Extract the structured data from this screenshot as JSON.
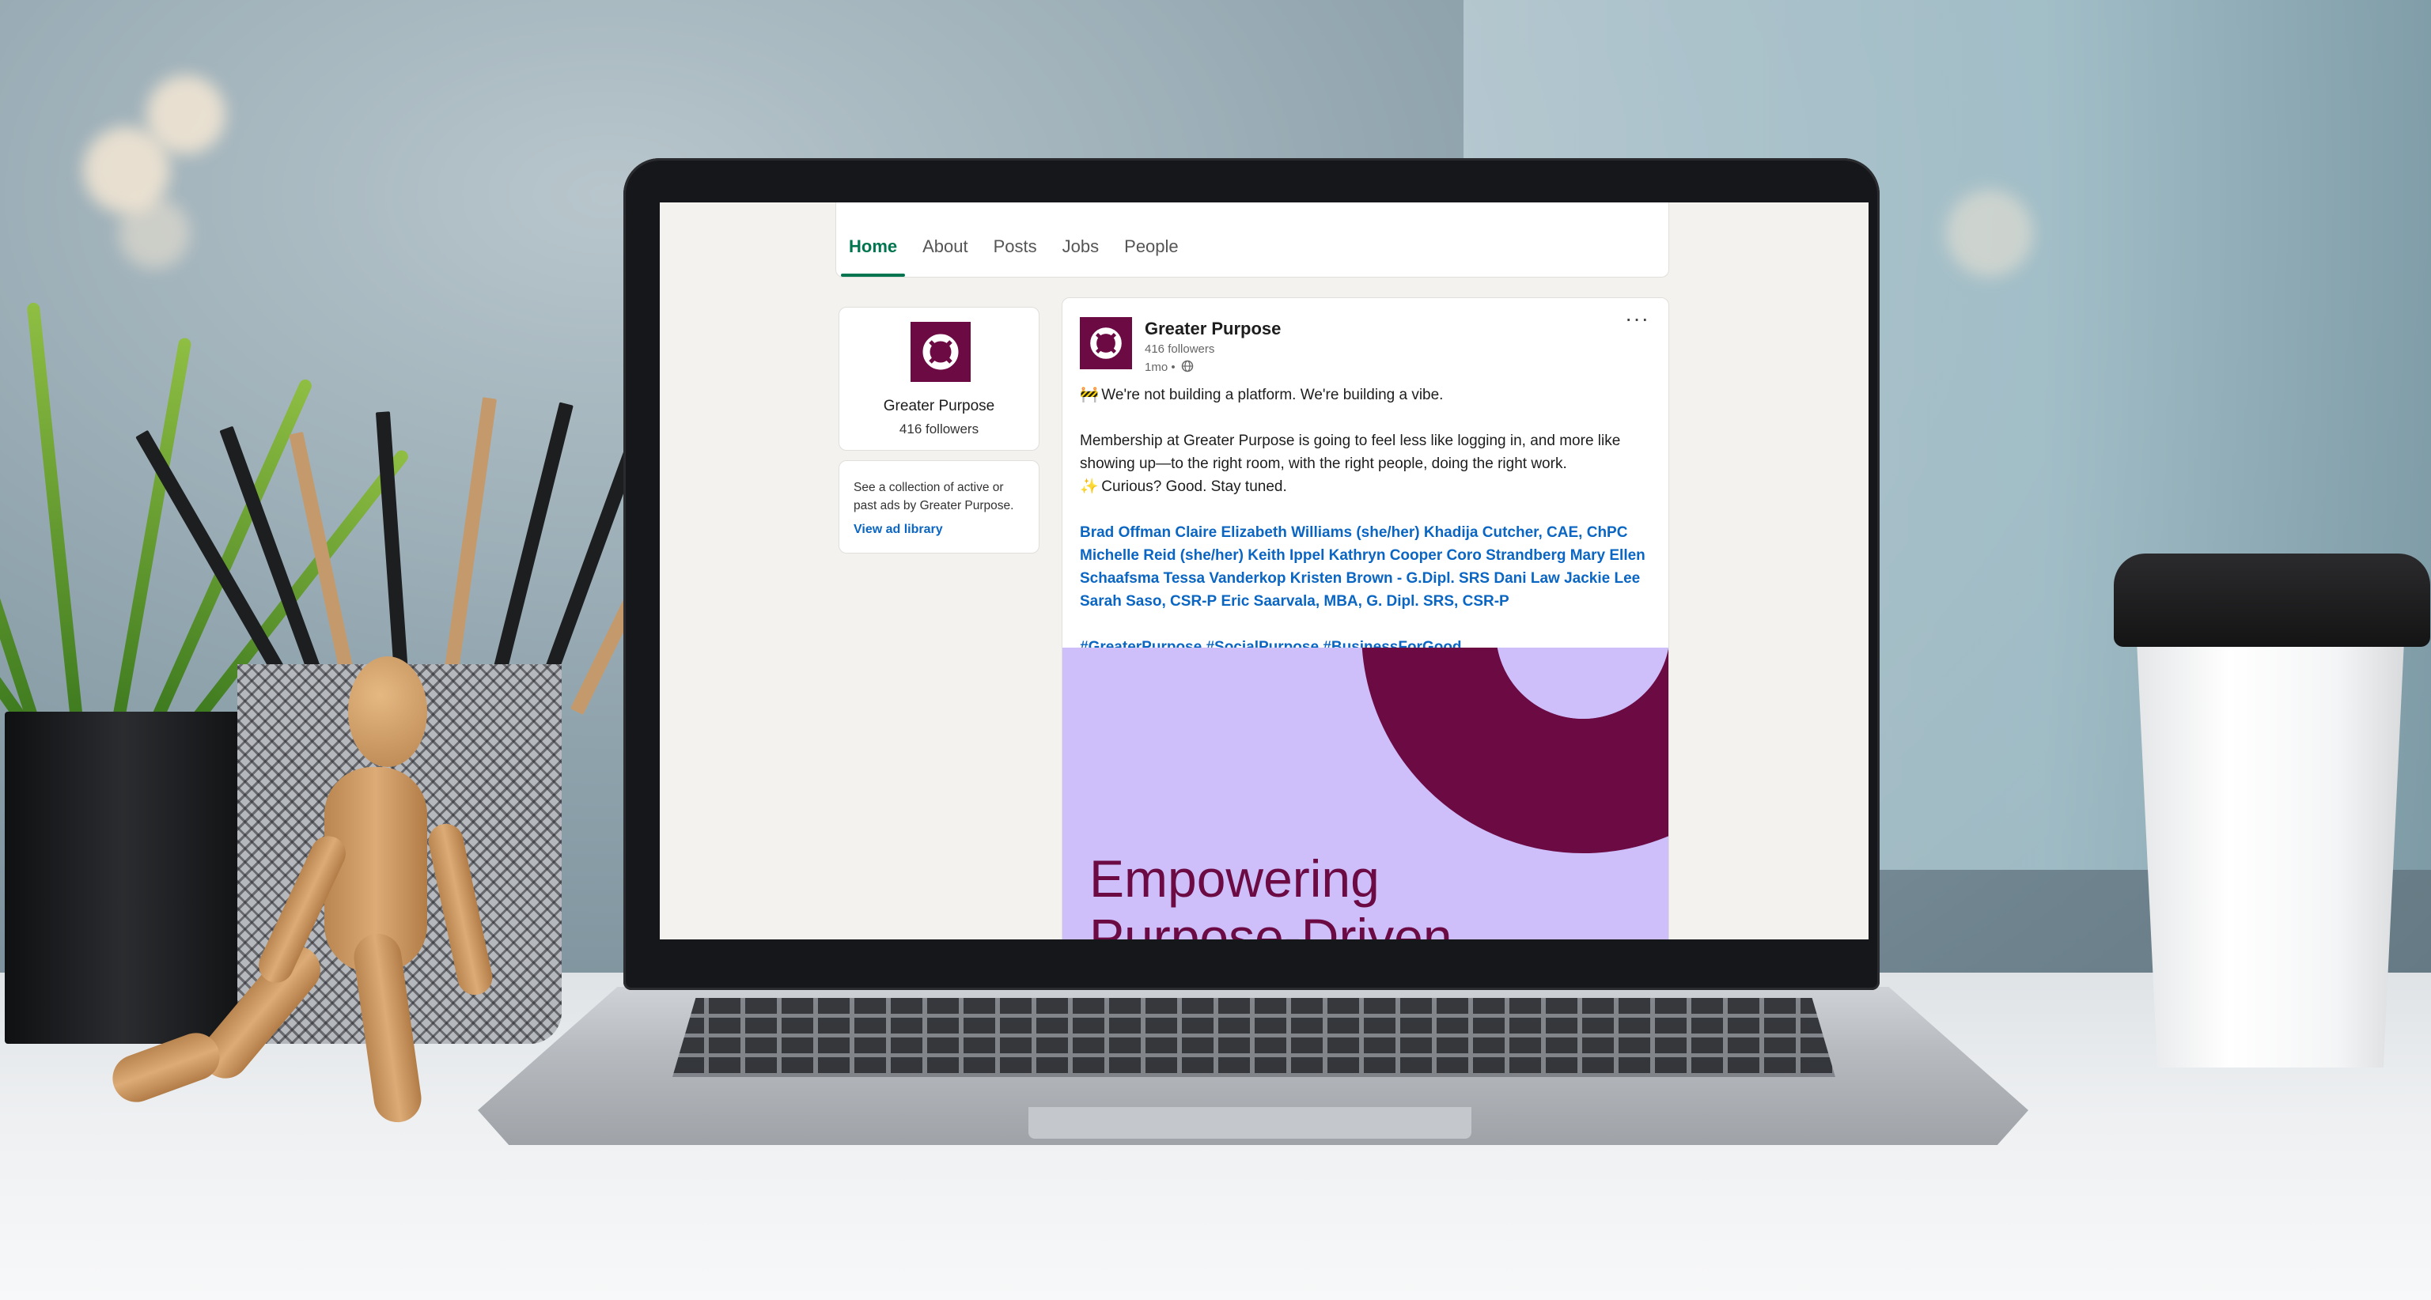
{
  "page": {
    "tabs": [
      {
        "label": "Home",
        "active": true
      },
      {
        "label": "About",
        "active": false
      },
      {
        "label": "Posts",
        "active": false
      },
      {
        "label": "Jobs",
        "active": false
      },
      {
        "label": "People",
        "active": false
      }
    ]
  },
  "company_card": {
    "name": "Greater Purpose",
    "followers": "416 followers"
  },
  "ads_card": {
    "description": "See a collection of active or past ads by Greater Purpose.",
    "link": "View ad library"
  },
  "post": {
    "author": "Greater Purpose",
    "followers": "416 followers",
    "time": "1mo •",
    "visibility_icon": "globe-icon",
    "more_label": "···",
    "line1_icon": "construction-sign",
    "line1": "We're not building a platform. We're building a vibe.",
    "line2": "Membership at Greater Purpose is going to feel less like logging in, and more like showing up—to the right room, with the right people, doing the right work.",
    "line3_icon": "sparkles",
    "line3": "Curious? Good. Stay tuned.",
    "mentions": [
      "Brad Offman",
      "Claire Elizabeth Williams (she/her)",
      "Khadija Cutcher, CAE, ChPC",
      "Michelle Reid (she/her)",
      "Keith Ippel",
      "Kathryn Cooper",
      "Coro Strandberg",
      "Mary Ellen Schaafsma",
      "Tessa Vanderkop",
      "Kristen Brown - G.Dipl. SRS",
      "Dani Law",
      "Jackie Lee",
      "Sarah Saso, CSR-P",
      "Eric Saarvala, MBA, G. Dipl. SRS, CSR-P"
    ],
    "hashtags": "#GreaterPurpose #SocialPurpose #BusinessForGood",
    "image_headline_1": "Empowering",
    "image_headline_2": "Purpose-Driven"
  },
  "colors": {
    "brand": "#6b0a43",
    "accent_green": "#01754f",
    "link_blue": "#0a66c2",
    "image_bg": "#cebefa"
  }
}
